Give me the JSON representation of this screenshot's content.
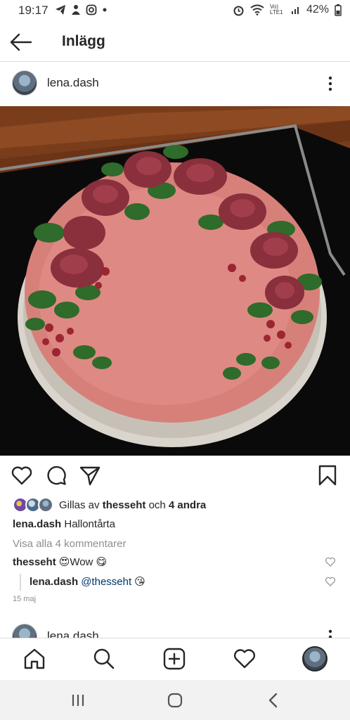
{
  "status_bar": {
    "time": "19:17",
    "battery": "42%",
    "signal_label": "Vo) LTE1",
    "left_icons": [
      "telegram-icon",
      "notification-icon",
      "instagram-icon",
      "dot-icon"
    ],
    "right_icons": [
      "alarm-icon",
      "wifi-icon",
      "signal-icon",
      "battery-icon"
    ]
  },
  "header": {
    "title": "Inlägg"
  },
  "post": {
    "author": "lena.dash",
    "photo_alt": "cake",
    "likes": {
      "prefix": "Gillas av",
      "user": "thesseht",
      "connector": "och",
      "others": "4 andra"
    },
    "caption": {
      "user": "lena.dash",
      "text": "Hallontårta"
    },
    "view_all": "Visa alla 4 kommentarer",
    "comments": [
      {
        "user": "thesseht",
        "text": "😍Wow 😋"
      },
      {
        "user": "lena.dash",
        "mention": "@thesseht",
        "text": "😘"
      }
    ],
    "date": "15 maj"
  },
  "next_post": {
    "author": "lena.dash"
  },
  "colors": {
    "text": "#262626",
    "muted": "#8e8e8e",
    "mention": "#00376b",
    "divider": "#dbdbdb"
  }
}
